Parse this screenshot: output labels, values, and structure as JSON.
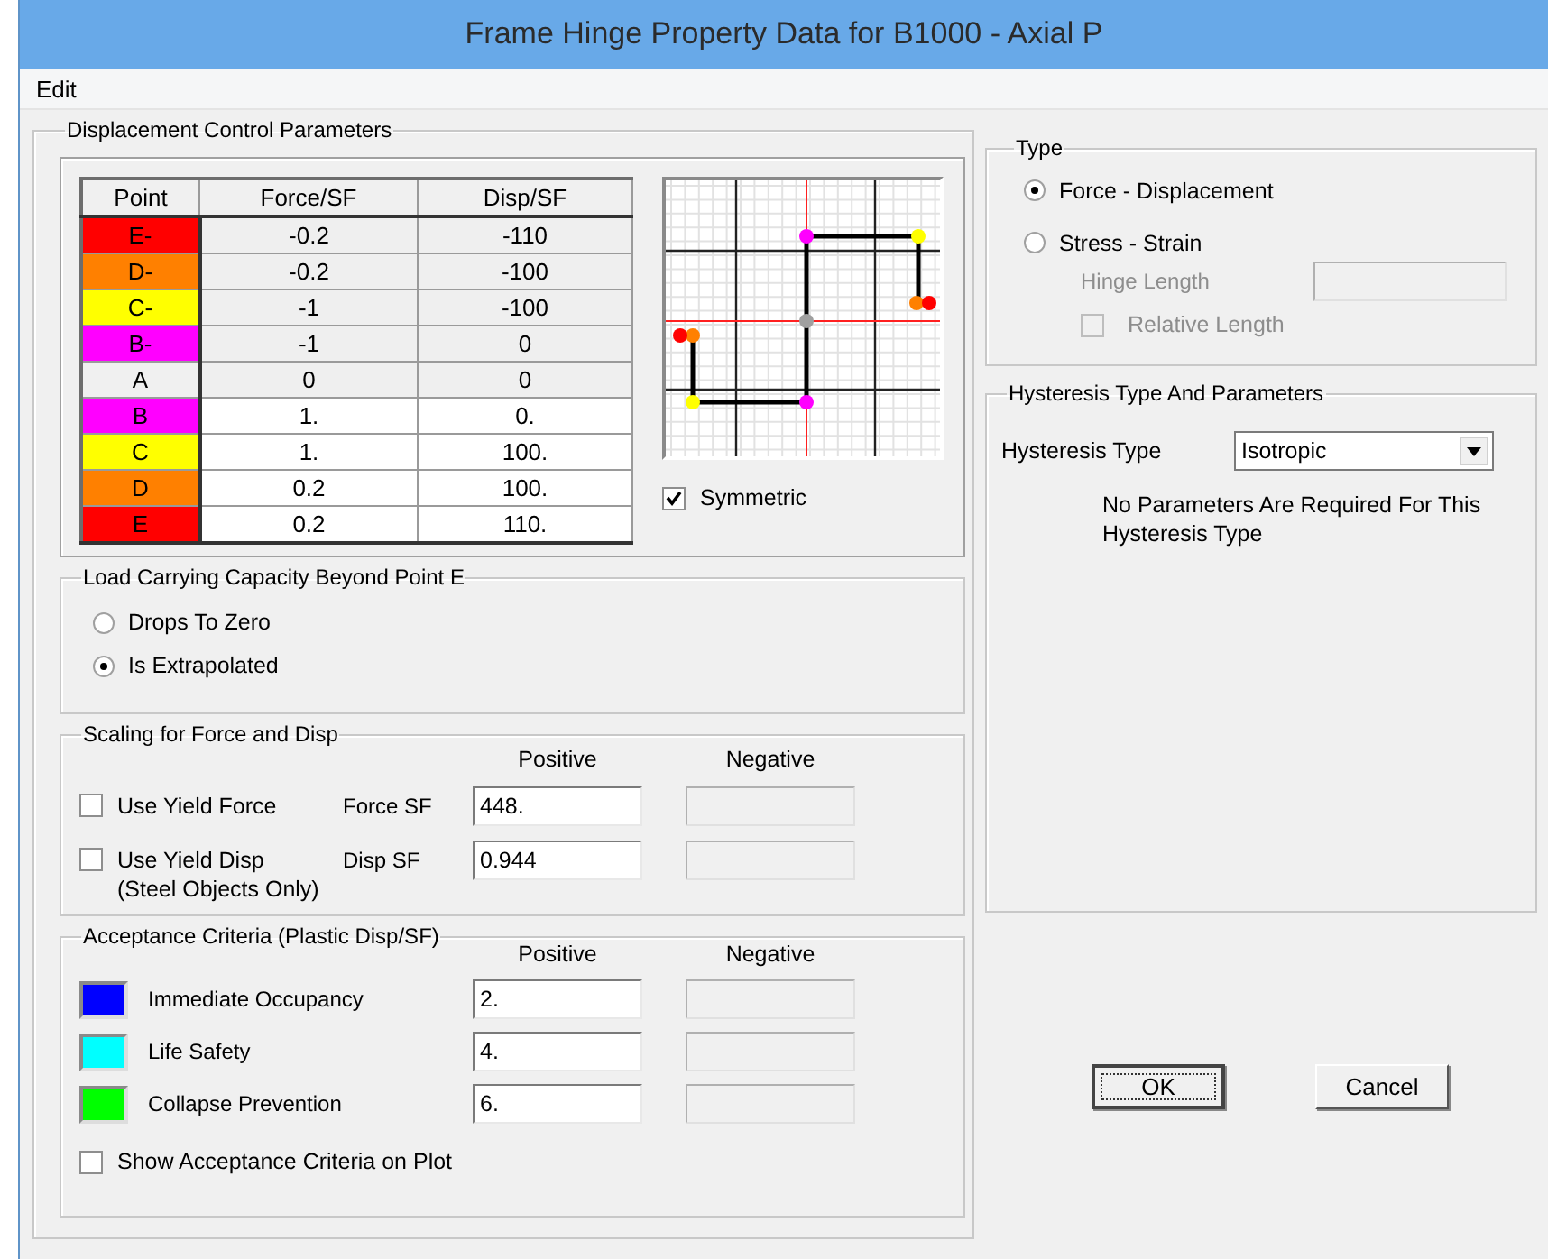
{
  "window": {
    "title": "Frame Hinge Property Data for B1000 - Axial P"
  },
  "menu": [
    "Edit"
  ],
  "displacement_control": {
    "title": "Displacement Control Parameters",
    "table": {
      "columns": [
        "Point",
        "Force/SF",
        "Disp/SF"
      ],
      "rows": [
        {
          "point": "E-",
          "color": "#ff0000",
          "force": "-0.2",
          "disp": "-110",
          "disabled": true
        },
        {
          "point": "D-",
          "color": "#ff8000",
          "force": "-0.2",
          "disp": "-100",
          "disabled": true
        },
        {
          "point": "C-",
          "color": "#ffff00",
          "force": "-1",
          "disp": "-100",
          "disabled": true
        },
        {
          "point": "B-",
          "color": "#ff00ff",
          "force": "-1",
          "disp": "0",
          "disabled": true
        },
        {
          "point": "A",
          "color": "#f0f0f0",
          "force": "0",
          "disp": "0",
          "disabled": true
        },
        {
          "point": "B",
          "color": "#ff00ff",
          "force": "1.",
          "disp": "0.",
          "disabled": false
        },
        {
          "point": "C",
          "color": "#ffff00",
          "force": "1.",
          "disp": "100.",
          "disabled": false
        },
        {
          "point": "D",
          "color": "#ff8000",
          "force": "0.2",
          "disp": "100.",
          "disabled": false
        },
        {
          "point": "E",
          "color": "#ff0000",
          "force": "0.2",
          "disp": "110.",
          "disabled": false
        }
      ]
    },
    "symmetric": {
      "label": "Symmetric",
      "checked": true
    },
    "load_capacity": {
      "title": "Load Carrying Capacity Beyond Point E",
      "options": [
        {
          "label": "Drops To Zero",
          "selected": false
        },
        {
          "label": "Is Extrapolated",
          "selected": true
        }
      ]
    },
    "scaling": {
      "title": "Scaling for Force and Disp",
      "columns": [
        "Positive",
        "Negative"
      ],
      "rows": [
        {
          "checkbox": "Use Yield Force",
          "checked": false,
          "label": "Force SF",
          "positive": "448.",
          "negative_disabled": true
        },
        {
          "checkbox": "Use Yield Disp",
          "note": "(Steel Objects Only)",
          "checked": false,
          "label": "Disp SF",
          "positive": "0.944",
          "negative_disabled": true
        }
      ]
    },
    "acceptance": {
      "title": "Acceptance Criteria (Plastic Disp/SF)",
      "columns": [
        "Positive",
        "Negative"
      ],
      "rows": [
        {
          "label": "Immediate Occupancy",
          "color": "#0000ff",
          "positive": "2.",
          "negative_disabled": true
        },
        {
          "label": "Life Safety",
          "color": "#00ffff",
          "positive": "4.",
          "negative_disabled": true
        },
        {
          "label": "Collapse Prevention",
          "color": "#00ff00",
          "positive": "6.",
          "negative_disabled": true
        }
      ],
      "show_on_plot": {
        "label": "Show Acceptance Criteria on Plot",
        "checked": false
      }
    }
  },
  "type": {
    "title": "Type",
    "options": [
      {
        "label": "Force - Displacement",
        "selected": true
      },
      {
        "label": "Stress - Strain",
        "selected": false
      }
    ],
    "hinge_length": {
      "label": "Hinge Length",
      "disabled": true
    },
    "relative_length": {
      "label": "Relative Length",
      "checked": false,
      "disabled": true
    }
  },
  "hysteresis": {
    "title": "Hysteresis Type And Parameters",
    "label": "Hysteresis Type",
    "value": "Isotropic",
    "note": "No Parameters Are Required For This Hysteresis Type"
  },
  "buttons": [
    {
      "label": "OK",
      "focused": true
    },
    {
      "label": "Cancel",
      "focused": false
    }
  ]
}
